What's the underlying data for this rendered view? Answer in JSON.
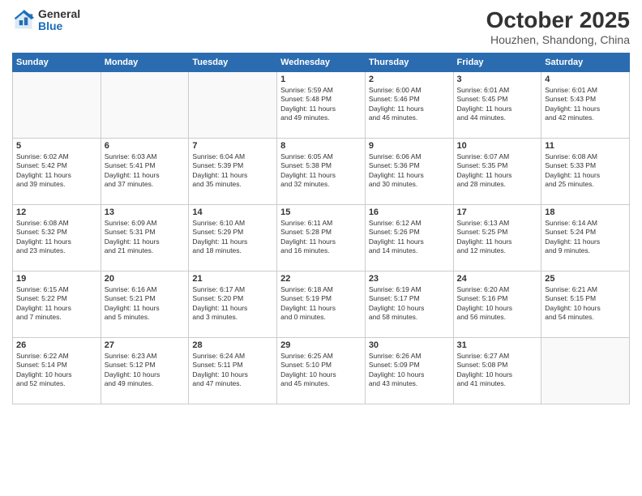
{
  "header": {
    "logo": {
      "general": "General",
      "blue": "Blue"
    },
    "title": "October 2025",
    "subtitle": "Houzhen, Shandong, China"
  },
  "weekdays": [
    "Sunday",
    "Monday",
    "Tuesday",
    "Wednesday",
    "Thursday",
    "Friday",
    "Saturday"
  ],
  "weeks": [
    [
      {
        "day": "",
        "info": ""
      },
      {
        "day": "",
        "info": ""
      },
      {
        "day": "",
        "info": ""
      },
      {
        "day": "1",
        "info": "Sunrise: 5:59 AM\nSunset: 5:48 PM\nDaylight: 11 hours\nand 49 minutes."
      },
      {
        "day": "2",
        "info": "Sunrise: 6:00 AM\nSunset: 5:46 PM\nDaylight: 11 hours\nand 46 minutes."
      },
      {
        "day": "3",
        "info": "Sunrise: 6:01 AM\nSunset: 5:45 PM\nDaylight: 11 hours\nand 44 minutes."
      },
      {
        "day": "4",
        "info": "Sunrise: 6:01 AM\nSunset: 5:43 PM\nDaylight: 11 hours\nand 42 minutes."
      }
    ],
    [
      {
        "day": "5",
        "info": "Sunrise: 6:02 AM\nSunset: 5:42 PM\nDaylight: 11 hours\nand 39 minutes."
      },
      {
        "day": "6",
        "info": "Sunrise: 6:03 AM\nSunset: 5:41 PM\nDaylight: 11 hours\nand 37 minutes."
      },
      {
        "day": "7",
        "info": "Sunrise: 6:04 AM\nSunset: 5:39 PM\nDaylight: 11 hours\nand 35 minutes."
      },
      {
        "day": "8",
        "info": "Sunrise: 6:05 AM\nSunset: 5:38 PM\nDaylight: 11 hours\nand 32 minutes."
      },
      {
        "day": "9",
        "info": "Sunrise: 6:06 AM\nSunset: 5:36 PM\nDaylight: 11 hours\nand 30 minutes."
      },
      {
        "day": "10",
        "info": "Sunrise: 6:07 AM\nSunset: 5:35 PM\nDaylight: 11 hours\nand 28 minutes."
      },
      {
        "day": "11",
        "info": "Sunrise: 6:08 AM\nSunset: 5:33 PM\nDaylight: 11 hours\nand 25 minutes."
      }
    ],
    [
      {
        "day": "12",
        "info": "Sunrise: 6:08 AM\nSunset: 5:32 PM\nDaylight: 11 hours\nand 23 minutes."
      },
      {
        "day": "13",
        "info": "Sunrise: 6:09 AM\nSunset: 5:31 PM\nDaylight: 11 hours\nand 21 minutes."
      },
      {
        "day": "14",
        "info": "Sunrise: 6:10 AM\nSunset: 5:29 PM\nDaylight: 11 hours\nand 18 minutes."
      },
      {
        "day": "15",
        "info": "Sunrise: 6:11 AM\nSunset: 5:28 PM\nDaylight: 11 hours\nand 16 minutes."
      },
      {
        "day": "16",
        "info": "Sunrise: 6:12 AM\nSunset: 5:26 PM\nDaylight: 11 hours\nand 14 minutes."
      },
      {
        "day": "17",
        "info": "Sunrise: 6:13 AM\nSunset: 5:25 PM\nDaylight: 11 hours\nand 12 minutes."
      },
      {
        "day": "18",
        "info": "Sunrise: 6:14 AM\nSunset: 5:24 PM\nDaylight: 11 hours\nand 9 minutes."
      }
    ],
    [
      {
        "day": "19",
        "info": "Sunrise: 6:15 AM\nSunset: 5:22 PM\nDaylight: 11 hours\nand 7 minutes."
      },
      {
        "day": "20",
        "info": "Sunrise: 6:16 AM\nSunset: 5:21 PM\nDaylight: 11 hours\nand 5 minutes."
      },
      {
        "day": "21",
        "info": "Sunrise: 6:17 AM\nSunset: 5:20 PM\nDaylight: 11 hours\nand 3 minutes."
      },
      {
        "day": "22",
        "info": "Sunrise: 6:18 AM\nSunset: 5:19 PM\nDaylight: 11 hours\nand 0 minutes."
      },
      {
        "day": "23",
        "info": "Sunrise: 6:19 AM\nSunset: 5:17 PM\nDaylight: 10 hours\nand 58 minutes."
      },
      {
        "day": "24",
        "info": "Sunrise: 6:20 AM\nSunset: 5:16 PM\nDaylight: 10 hours\nand 56 minutes."
      },
      {
        "day": "25",
        "info": "Sunrise: 6:21 AM\nSunset: 5:15 PM\nDaylight: 10 hours\nand 54 minutes."
      }
    ],
    [
      {
        "day": "26",
        "info": "Sunrise: 6:22 AM\nSunset: 5:14 PM\nDaylight: 10 hours\nand 52 minutes."
      },
      {
        "day": "27",
        "info": "Sunrise: 6:23 AM\nSunset: 5:12 PM\nDaylight: 10 hours\nand 49 minutes."
      },
      {
        "day": "28",
        "info": "Sunrise: 6:24 AM\nSunset: 5:11 PM\nDaylight: 10 hours\nand 47 minutes."
      },
      {
        "day": "29",
        "info": "Sunrise: 6:25 AM\nSunset: 5:10 PM\nDaylight: 10 hours\nand 45 minutes."
      },
      {
        "day": "30",
        "info": "Sunrise: 6:26 AM\nSunset: 5:09 PM\nDaylight: 10 hours\nand 43 minutes."
      },
      {
        "day": "31",
        "info": "Sunrise: 6:27 AM\nSunset: 5:08 PM\nDaylight: 10 hours\nand 41 minutes."
      },
      {
        "day": "",
        "info": ""
      }
    ]
  ]
}
